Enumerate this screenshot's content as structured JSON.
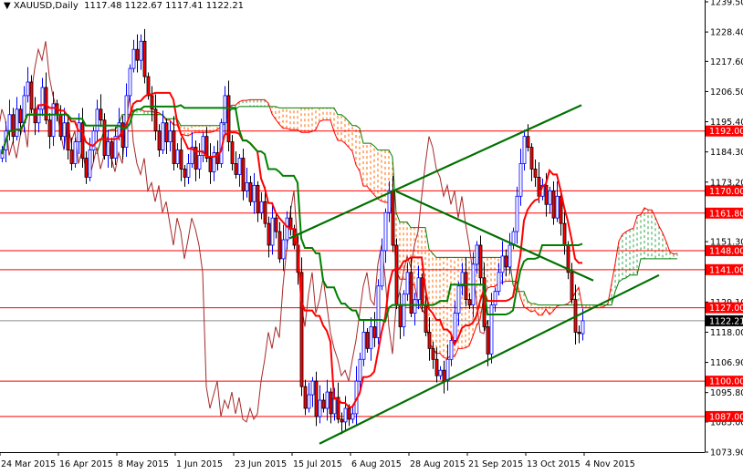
{
  "header": {
    "symbol": "XAUUSD,Daily",
    "ohlc": "1117.48 1122.67 1117.41 1122.21"
  },
  "chart_data": {
    "type": "candlestick",
    "title": "XAUUSD,Daily",
    "ylim": [
      1073.9,
      1239.5
    ],
    "y_ticks": [
      1239.5,
      1228.4,
      1217.6,
      1206.5,
      1195.4,
      1184.3,
      1173.2,
      1162.1,
      1151.3,
      1140.2,
      1129.1,
      1118.0,
      1106.9,
      1095.8,
      1085.0,
      1073.9
    ],
    "x_labels": [
      {
        "bar": 0,
        "label": "24 Mar 2015"
      },
      {
        "bar": 16,
        "label": "16 Apr 2015"
      },
      {
        "bar": 32,
        "label": "8 May 2015"
      },
      {
        "bar": 48,
        "label": "1 Jun 2015"
      },
      {
        "bar": 64,
        "label": "23 Jun 2015"
      },
      {
        "bar": 80,
        "label": "15 Jul 2015"
      },
      {
        "bar": 96,
        "label": "6 Aug 2015"
      },
      {
        "bar": 112,
        "label": "28 Aug 2015"
      },
      {
        "bar": 128,
        "label": "21 Sep 2015"
      },
      {
        "bar": 144,
        "label": "13 Oct 2015"
      },
      {
        "bar": 160,
        "label": "4 Nov 2015"
      }
    ],
    "closes": [
      1185,
      1192,
      1198,
      1190,
      1200,
      1195,
      1205,
      1210,
      1200,
      1195,
      1200,
      1208,
      1196,
      1190,
      1202,
      1198,
      1190,
      1195,
      1185,
      1180,
      1188,
      1195,
      1182,
      1175,
      1185,
      1192,
      1200,
      1196,
      1183,
      1188,
      1182,
      1190,
      1195,
      1186,
      1205,
      1215,
      1222,
      1218,
      1225,
      1212,
      1205,
      1200,
      1192,
      1185,
      1195,
      1188,
      1192,
      1180,
      1185,
      1178,
      1175,
      1180,
      1186,
      1178,
      1183,
      1190,
      1182,
      1177,
      1184,
      1180,
      1195,
      1205,
      1188,
      1180,
      1176,
      1182,
      1170,
      1173,
      1166,
      1172,
      1162,
      1166,
      1158,
      1150,
      1160,
      1155,
      1145,
      1152,
      1160,
      1156,
      1150,
      1140,
      1098,
      1090,
      1095,
      1100,
      1087,
      1093,
      1090,
      1096,
      1088,
      1094,
      1086,
      1085,
      1090,
      1086,
      1088,
      1100,
      1108,
      1118,
      1112,
      1120,
      1116,
      1135,
      1148,
      1162,
      1170,
      1150,
      1128,
      1120,
      1132,
      1140,
      1125,
      1130,
      1138,
      1128,
      1118,
      1112,
      1108,
      1102,
      1104,
      1100,
      1108,
      1115,
      1125,
      1135,
      1140,
      1130,
      1128,
      1143,
      1150,
      1138,
      1120,
      1110,
      1128,
      1133,
      1140,
      1146,
      1142,
      1150,
      1155,
      1168,
      1180,
      1190,
      1186,
      1178,
      1175,
      1168,
      1172,
      1165,
      1170,
      1160,
      1168,
      1158,
      1150,
      1140,
      1130,
      1118,
      1117.48,
      1122.21
    ],
    "indicator": "Ichimoku (9, 26, 52)",
    "levels": [
      {
        "price": 1192.0,
        "label": "1192.00"
      },
      {
        "price": 1170.0,
        "label": "1170.00"
      },
      {
        "price": 1161.8,
        "label": "1161.80"
      },
      {
        "price": 1148.0,
        "label": "1148.00"
      },
      {
        "price": 1141.0,
        "label": "1141.00"
      },
      {
        "price": 1127.0,
        "label": "1127.00"
      },
      {
        "price": 1100.0,
        "label": "1100.00"
      },
      {
        "price": 1087.0,
        "label": "1087.00"
      }
    ],
    "current_price": {
      "price": 1122.21,
      "label": "1122.21"
    },
    "trendlines": [
      {
        "from": [
          78.75,
          1152.5
        ],
        "to": [
          158.75,
          1201.5
        ]
      },
      {
        "from": [
          108,
          1169.8
        ],
        "to": [
          162,
          1137.0
        ]
      },
      {
        "from": [
          87,
          1077.0
        ],
        "to": [
          180,
          1139.0
        ]
      }
    ],
    "colors": {
      "bull": "#0000ff",
      "bear": "#ff0000",
      "level": "#ff0000",
      "tenkan": "#ff0000",
      "kijun": "#008000",
      "chikou": "#a52a2a",
      "trend": "#007000",
      "cloud_bear": "#ff6a00",
      "cloud_bull": "#2aa84a"
    }
  }
}
